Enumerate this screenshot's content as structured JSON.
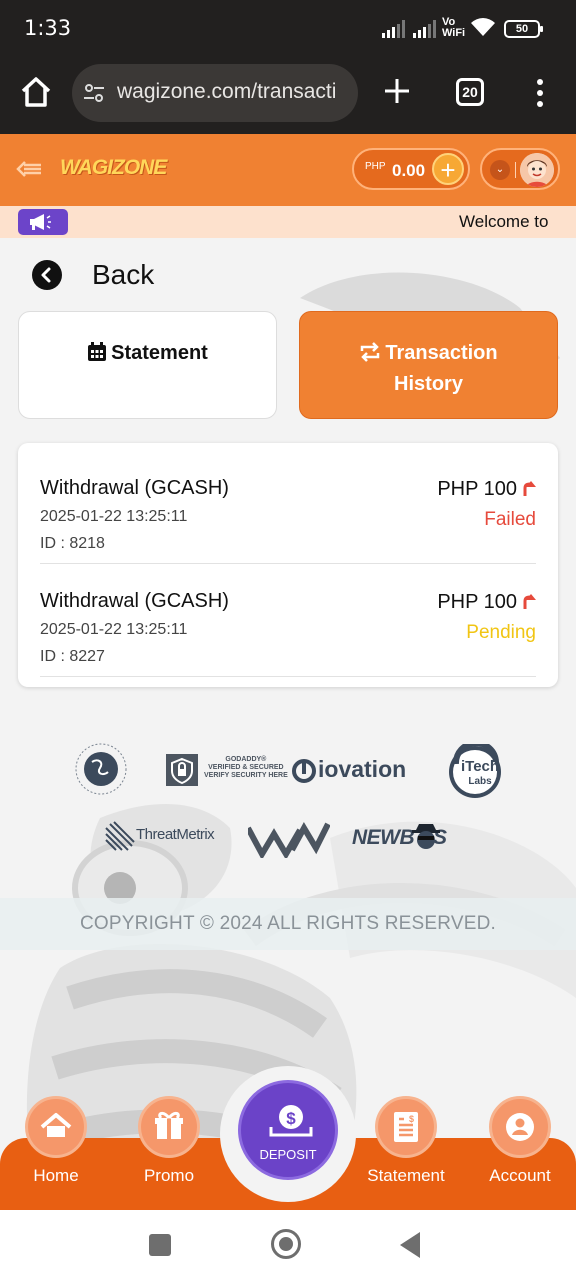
{
  "status_bar": {
    "time": "1:33",
    "network_label": "Vo WiFi",
    "network_line1": "Vo",
    "network_line2": "WiFi",
    "battery": "50"
  },
  "browser": {
    "url": "wagizone.com/transacti",
    "tab_count": "20"
  },
  "site_header": {
    "logo_text": "WAGIZONE",
    "wallet_currency": "PHP",
    "wallet_amount": "0.00",
    "add_symbol": "+"
  },
  "announcement": {
    "text": "Welcome to"
  },
  "back": {
    "label": "Back"
  },
  "tabs": [
    {
      "label": "Statement",
      "icon": "calendar-icon",
      "active": false
    },
    {
      "label": "Transaction History",
      "line1": "Transaction",
      "line2": "History",
      "icon": "swap-arrows-icon",
      "active": true
    }
  ],
  "transactions": [
    {
      "title": "Withdrawal (GCASH)",
      "datetime": "2025-01-22 13:25:11",
      "id": "ID : 8218",
      "amount": "PHP 100",
      "status": "Failed",
      "direction": "up-arrow-icon"
    },
    {
      "title": "Withdrawal (GCASH)",
      "datetime": "2025-01-22 13:25:11",
      "id": "ID : 8227",
      "amount": "PHP 100",
      "status": "Pending",
      "direction": "up-arrow-icon"
    }
  ],
  "partners": [
    "GAMING LABORATORIES INTERNATIONAL",
    "GODADDY® VERIFIED & SECURED VERIFY SECURITY HERE",
    "iovation",
    "iTech Labs",
    "ThreatMetrix",
    "WW",
    "NEWBOSS"
  ],
  "partner_texts": {
    "godaddy_l1": "GODADDY®",
    "godaddy_l2": "VERIFIED & SECURED",
    "godaddy_l3": "VERIFY SECURITY HERE",
    "iovation": "iovation",
    "itech": "iTech",
    "itech_sub": "Labs",
    "threatmetrix": "ThreatMetrix",
    "newboss": "NEWB SS"
  },
  "footer": {
    "copyright": "COPYRIGHT © 2024 ALL RIGHTS RESERVED."
  },
  "bottom_nav": {
    "home": "Home",
    "promo": "Promo",
    "deposit": "DEPOSIT",
    "statement": "Statement",
    "account": "Account"
  },
  "colors": {
    "brand_orange": "#f08132",
    "nav_orange": "#e85f12",
    "deposit_purple": "#6b43c8",
    "failed_red": "#e64a3c",
    "pending_yellow": "#f1c514",
    "browser_dark": "#22201f"
  }
}
